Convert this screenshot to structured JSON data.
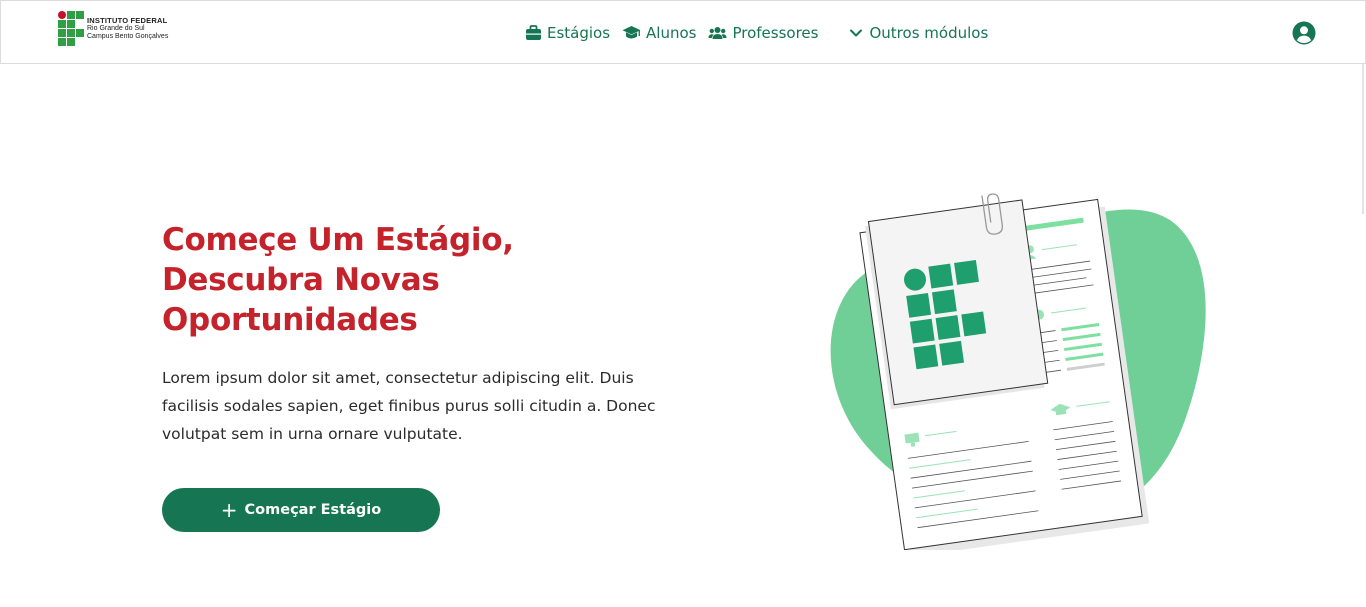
{
  "header": {
    "logo": {
      "line1": "INSTITUTO FEDERAL",
      "line2": "Rio Grande do Sul",
      "line3": "Campus Bento Gonçalves",
      "colors": {
        "red": "#c8102e",
        "green": "#2f9e44"
      }
    },
    "nav": [
      {
        "label": "Estágios",
        "icon": "briefcase-icon"
      },
      {
        "label": "Alunos",
        "icon": "graduation-cap-icon"
      },
      {
        "label": "Professores",
        "icon": "users-icon"
      },
      {
        "label": "Outros módulos",
        "icon": "chevron-down-icon"
      }
    ],
    "user_icon": "user-circle-icon"
  },
  "hero": {
    "title_lines": [
      "Começe Um Estágio,",
      "Descubra Novas",
      "Oportunidades"
    ],
    "text_lines": [
      "Lorem ipsum dolor sit amet, consectetur adipiscing elit. Duis",
      "facilisis sodales sapien, eget finibus purus solli citudin a. Donec",
      "volutpat sem in urna ornare vulputate."
    ],
    "cta_label": "Começar Estágio",
    "cta_icon": "plus-icon"
  },
  "illustration": {
    "name": "document-with-logo-illustration",
    "colors": {
      "blob": "#6fcf97",
      "logo": "#1f9e6e",
      "paper": "#ffffff",
      "accent_lines": "#7ee0a0"
    }
  },
  "colors": {
    "primary": "#167552",
    "title": "#c4232b",
    "text": "#2b2b2b"
  }
}
